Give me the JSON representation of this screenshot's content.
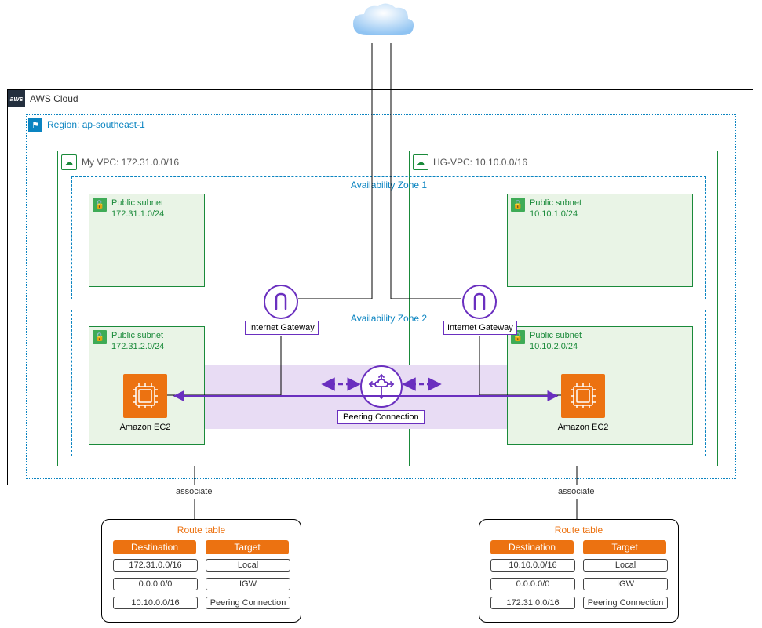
{
  "aws_cloud_label": "AWS Cloud",
  "region_label": "Region: ap-southeast-1",
  "vpc_left": {
    "label": "My VPC: 172.31.0.0/16"
  },
  "vpc_right": {
    "label": "HG-VPC: 10.10.0.0/16"
  },
  "az1_label": "Availability Zone 1",
  "az2_label": "Availability Zone 2",
  "subnet_left_top": {
    "name": "Public subnet",
    "cidr": "172.31.1.0/24"
  },
  "subnet_right_top": {
    "name": "Public subnet",
    "cidr": "10.10.1.0/24"
  },
  "subnet_left_bot": {
    "name": "Public subnet",
    "cidr": "172.31.2.0/24"
  },
  "subnet_right_bot": {
    "name": "Public subnet",
    "cidr": "10.10.2.0/24"
  },
  "ec2_label": "Amazon  EC2",
  "igw_label": "Internet Gateway",
  "peering_label": "Peering Connection",
  "associate_label": "associate",
  "route_table_title": "Route table",
  "route_table_headers": {
    "dest": "Destination",
    "target": "Target"
  },
  "route_left": {
    "rows": [
      {
        "dest": "172.31.0.0/16",
        "target": "Local"
      },
      {
        "dest": "0.0.0.0/0",
        "target": "IGW"
      },
      {
        "dest": "10.10.0.0/16",
        "target": "Peering Connection"
      }
    ]
  },
  "route_right": {
    "rows": [
      {
        "dest": "10.10.0.0/16",
        "target": "Local"
      },
      {
        "dest": "0.0.0.0/0",
        "target": "IGW"
      },
      {
        "dest": "172.31.0.0/16",
        "target": "Peering Connection"
      }
    ]
  }
}
